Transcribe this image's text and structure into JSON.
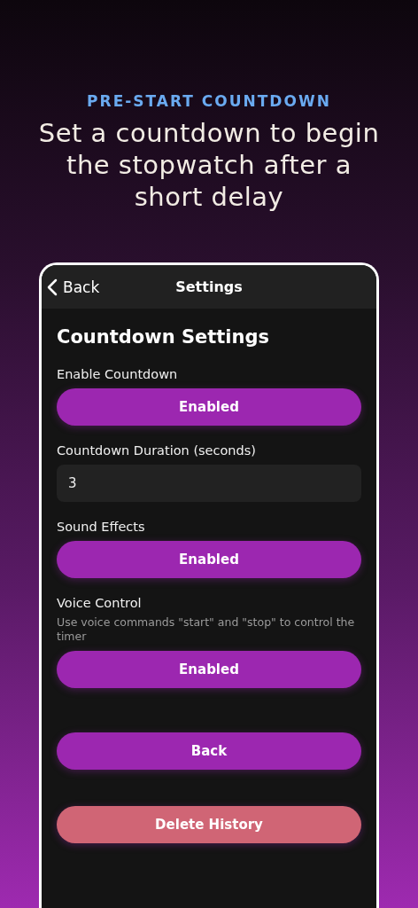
{
  "header": {
    "eyebrow": "PRE-START COUNTDOWN",
    "headline": "Set a countdown to begin the stopwatch after a short delay"
  },
  "nav_bar": {
    "back": "Back",
    "title": "Settings"
  },
  "section_title": "Countdown Settings",
  "settings": [
    {
      "kind": "toggle",
      "label": "Enable Countdown",
      "value": "Enabled",
      "on": true
    },
    {
      "kind": "number",
      "label": "Countdown Duration (seconds)",
      "value": "3"
    },
    {
      "kind": "toggle",
      "label": "Sound Effects",
      "value": "Enabled",
      "on": true
    },
    {
      "kind": "toggle",
      "label": "Voice Control",
      "description": "Use voice commands \"start\" and \"stop\" to control the timer",
      "value": "Enabled",
      "on": true
    }
  ],
  "actions": [
    {
      "kind": "primary",
      "label": "Back"
    },
    {
      "kind": "danger",
      "label": "Delete History"
    }
  ]
}
